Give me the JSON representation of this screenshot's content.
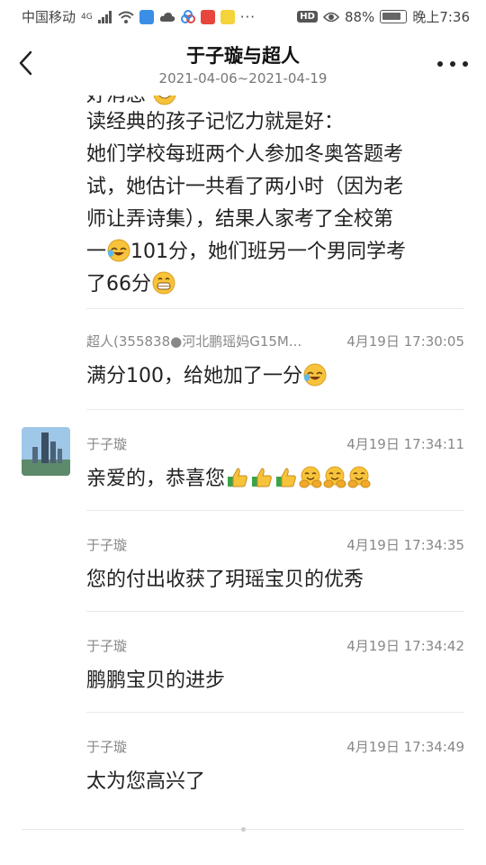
{
  "status_bar": {
    "carrier": "中国移动",
    "network": "4G",
    "battery_percent": "88%",
    "time": "晚上7:36"
  },
  "header": {
    "title": "于子璇与超人",
    "date_range": "2021-04-06~2021-04-19"
  },
  "first_message": {
    "cut_line": "好消息",
    "lines": [
      "读经典的孩子记忆力就是好：",
      "她们学校每班两个人参加冬奥答题考",
      "试，她估计一共看了两小时（因为老",
      "师让弄诗集），结果人家考了全校第",
      "一",
      "101分，她们班另一个男同学考",
      "了66分"
    ]
  },
  "messages": [
    {
      "sender": "超人(355838●河北鹏瑶妈G15M...",
      "time": "4月19日 17:30:05",
      "text": "满分100，给她加了一分"
    },
    {
      "sender": "于子璇",
      "time": "4月19日 17:34:11",
      "text": "亲爱的，恭喜您"
    },
    {
      "sender": "于子璇",
      "time": "4月19日 17:34:35",
      "text": "您的付出收获了玥瑶宝贝的优秀"
    },
    {
      "sender": "于子璇",
      "time": "4月19日 17:34:42",
      "text": "鹏鹏宝贝的进步"
    },
    {
      "sender": "于子璇",
      "time": "4月19日 17:34:49",
      "text": "太为您高兴了"
    }
  ],
  "icons": {
    "back": "chevron-left-icon",
    "more": "more-dots-icon",
    "emoji_cry_laugh": "crying-laughing-emoji",
    "emoji_grin": "grinning-emoji",
    "emoji_thumbs": "thumbs-up-emoji",
    "emoji_hug": "hugging-emoji"
  }
}
